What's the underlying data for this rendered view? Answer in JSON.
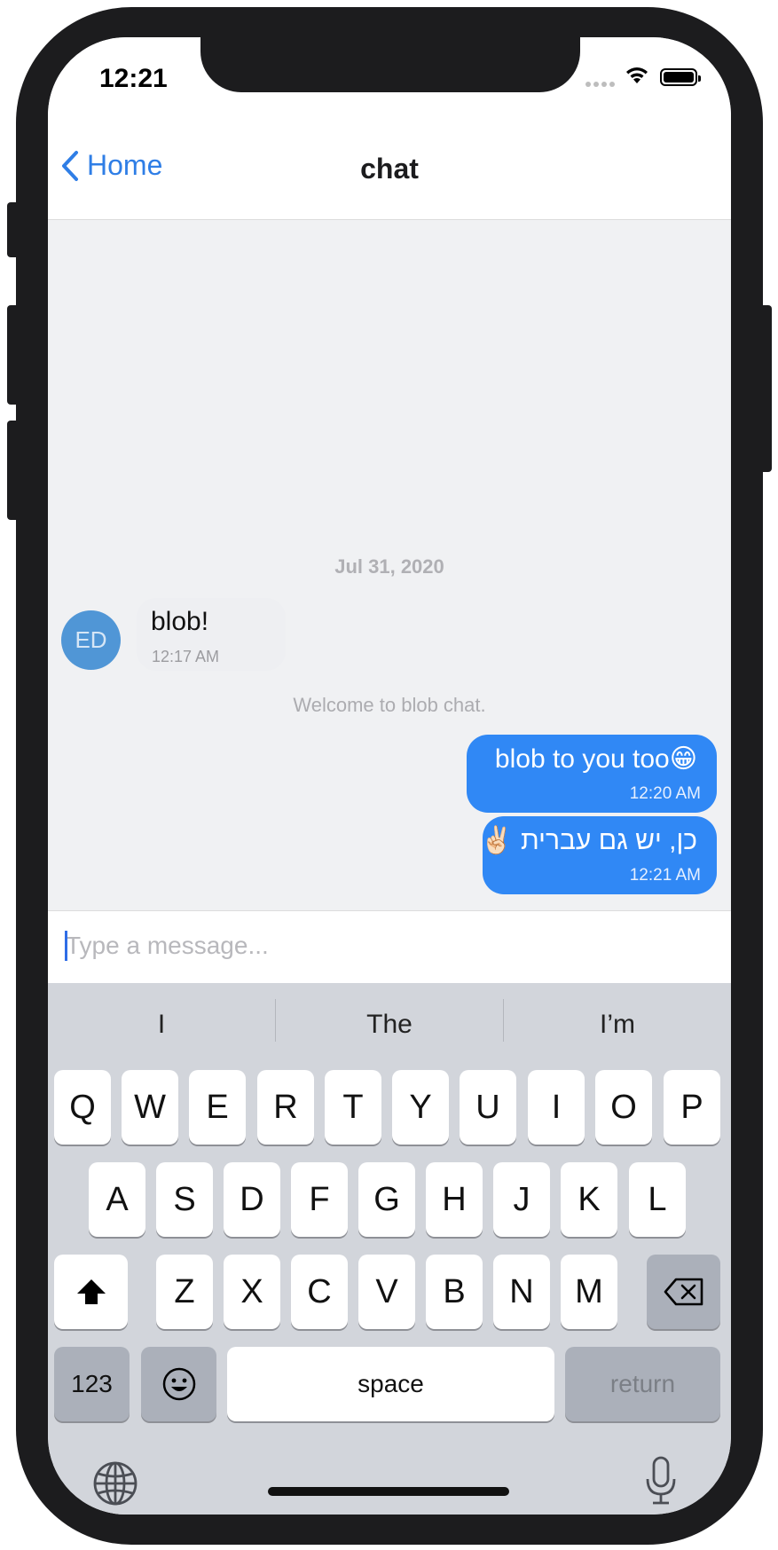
{
  "status_bar": {
    "time": "12:21",
    "signal_icon": "signal-dots-icon",
    "wifi_icon": "wifi-icon",
    "battery_icon": "battery-icon"
  },
  "nav": {
    "back_label": "Home",
    "back_icon": "chevron-left-icon",
    "title": "chat"
  },
  "chat": {
    "date_separator": "Jul 31, 2020",
    "incoming": {
      "avatar_initials": "ED",
      "text": "blob!",
      "time": "12:17 AM"
    },
    "system_message": "Welcome to blob chat.",
    "outgoing": [
      {
        "text": "blob to you too😁",
        "time": "12:20 AM"
      },
      {
        "text": "כן, יש גם עברית ✌🏻",
        "time": "12:21 AM"
      }
    ]
  },
  "composer": {
    "placeholder": "Type a message...",
    "value": ""
  },
  "keyboard": {
    "suggestions": [
      "I",
      "The",
      "I’m"
    ],
    "row1": [
      "Q",
      "W",
      "E",
      "R",
      "T",
      "Y",
      "U",
      "I",
      "O",
      "P"
    ],
    "row2": [
      "A",
      "S",
      "D",
      "F",
      "G",
      "H",
      "J",
      "K",
      "L"
    ],
    "row3": [
      "Z",
      "X",
      "C",
      "V",
      "B",
      "N",
      "M"
    ],
    "shift_icon": "shift-icon",
    "delete_icon": "backspace-icon",
    "numbers_label": "123",
    "emoji_label": "☺",
    "space_label": "space",
    "return_label": "return",
    "globe_icon": "globe-icon",
    "mic_icon": "microphone-icon"
  },
  "colors": {
    "accent": "#2f7ee6",
    "outgoing_bubble": "#3088f5",
    "avatar": "#5096d6",
    "chat_background": "#f0f1f3",
    "keyboard_background": "#d2d5db"
  }
}
